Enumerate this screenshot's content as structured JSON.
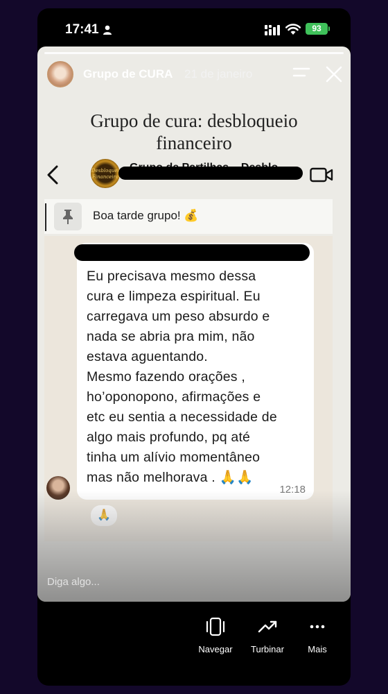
{
  "status_bar": {
    "time": "17:41",
    "battery": "93"
  },
  "story": {
    "author": "Grupo de CURA",
    "date": "21 de janeiro",
    "title_line1": "Grupo de cura: desbloqueio",
    "title_line2": "financeiro",
    "reply_placeholder": "Diga algo..."
  },
  "chat": {
    "group_name": "Grupo de Partilhas – Desblo...",
    "group_logo_text_1": "Desbloqueio",
    "group_logo_text_2": "Financeiro",
    "pinned_message": "Boa tarde grupo! 💰",
    "message_lines": [
      "Eu precisava mesmo dessa",
      "cura e limpeza espiritual. Eu",
      "carregava um peso absurdo e",
      "nada se abria pra mim, não",
      "estava aguentando.",
      "Mesmo fazendo orações ,",
      "ho’oponopono, afirmações e",
      "etc eu sentia a necessidade de",
      "algo mais profundo, pq até",
      "tinha um alívio momentâneo",
      "mas não melhorava . 🙏🙏"
    ],
    "message_time": "12:18",
    "reaction": "🙏"
  },
  "actions": [
    {
      "label": "Navegar",
      "icon": "phone-frame-icon"
    },
    {
      "label": "Turbinar",
      "icon": "trending-up-icon"
    },
    {
      "label": "Mais",
      "icon": "more-dots-icon"
    }
  ],
  "colors": {
    "page_bg": "#13082a",
    "story_bg": "#ecebe6",
    "battery": "#3fc15a",
    "bubble": "#ffffff"
  }
}
